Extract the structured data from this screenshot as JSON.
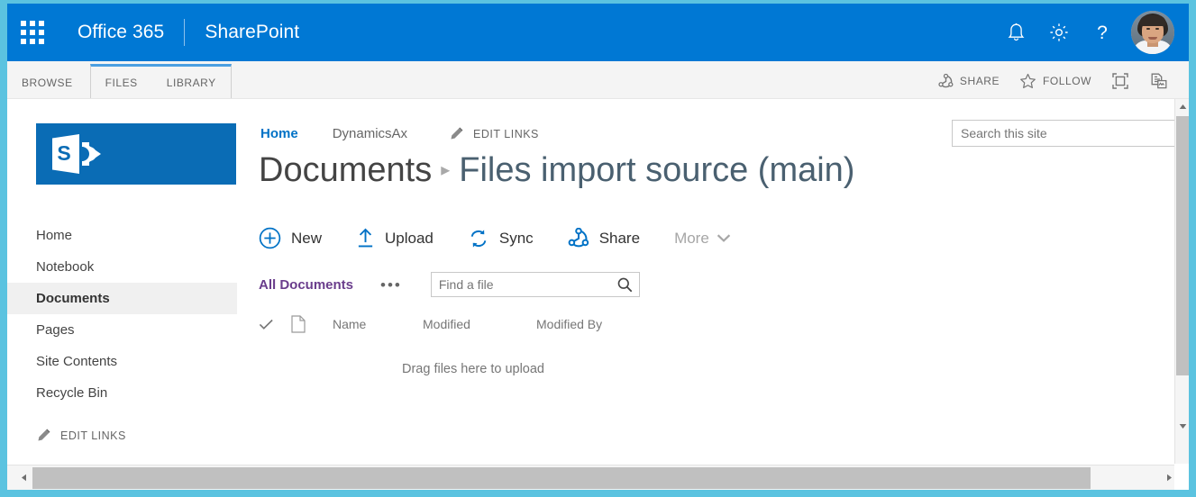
{
  "suite": {
    "waffle_label": "app-launcher",
    "office_label": "Office 365",
    "app_label": "SharePoint",
    "notifications_icon": "bell-icon",
    "settings_icon": "gear-icon",
    "help_icon": "question-mark-icon",
    "avatar_label": "user-avatar"
  },
  "ribbon": {
    "tabs": [
      {
        "label": "BROWSE",
        "active": false
      },
      {
        "label": "FILES",
        "active": true
      },
      {
        "label": "LIBRARY",
        "active": false
      }
    ],
    "share_label": "SHARE",
    "follow_label": "FOLLOW",
    "focus_icon": "focus-on-content-icon",
    "sync_icon": "page-sync-icon"
  },
  "sidebar": {
    "logo_letter": "S",
    "items": [
      {
        "label": "Home",
        "selected": false
      },
      {
        "label": "Notebook",
        "selected": false
      },
      {
        "label": "Documents",
        "selected": true
      },
      {
        "label": "Pages",
        "selected": false
      },
      {
        "label": "Site Contents",
        "selected": false
      },
      {
        "label": "Recycle Bin",
        "selected": false
      }
    ],
    "edit_links_label": "EDIT LINKS"
  },
  "toplinks": {
    "home_label": "Home",
    "items": [
      "DynamicsAx"
    ],
    "edit_links_label": "EDIT LINKS"
  },
  "title": {
    "parent": "Documents",
    "separator": "▸",
    "current": "Files import source (main)"
  },
  "site_search": {
    "placeholder": "Search this site",
    "value": ""
  },
  "commands": [
    {
      "label": "New",
      "icon": "plus-circle-icon"
    },
    {
      "label": "Upload",
      "icon": "upload-arrow-icon"
    },
    {
      "label": "Sync",
      "icon": "sync-icon"
    },
    {
      "label": "Share",
      "icon": "share-icon"
    }
  ],
  "more_label": "More",
  "view": {
    "name": "All Documents",
    "ellipsis": "•••",
    "find_placeholder": "Find a file",
    "find_value": ""
  },
  "list": {
    "columns": [
      "Name",
      "Modified",
      "Modified By"
    ],
    "rows": [],
    "empty_message": "Drag files here to upload"
  },
  "colors": {
    "suite_bar": "#0078d4",
    "accent_link": "#0072c6",
    "view_purple": "#6a3d8c",
    "window_border": "#5bc3e0",
    "selected_nav_bg": "#f0f0f0",
    "ribbon_bg": "#f4f4f4",
    "active_tab_top": "#4b9fe1"
  }
}
